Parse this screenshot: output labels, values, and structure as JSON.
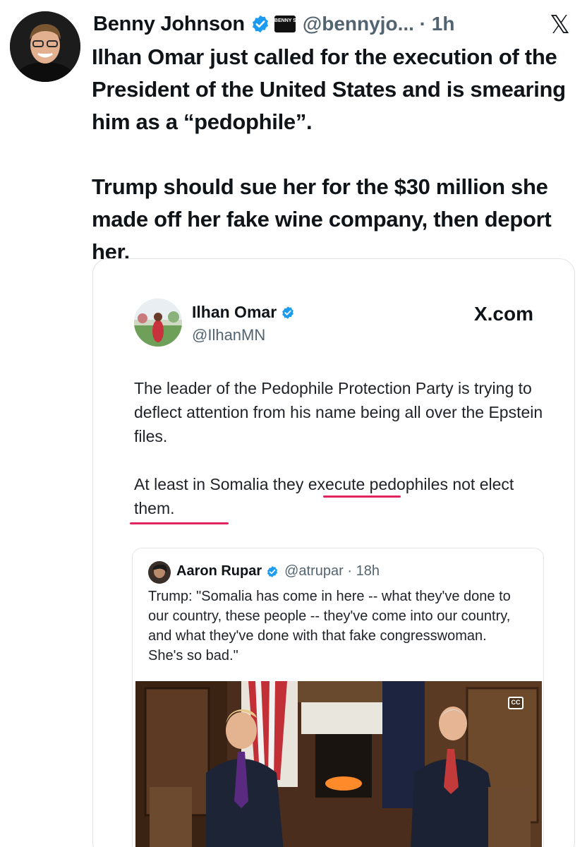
{
  "tweet": {
    "author_name": "Benny Johnson",
    "show_logo_text": "BENNY SHOW",
    "handle_time": "@bennyjo... · 1h",
    "x_logo": "𝕏",
    "paragraphs": [
      "Ilhan Omar just called for the execution of the President of the United States and is smearing him as a “pedophile”.",
      "Trump should sue her for the $30 million she made off her fake wine company, then deport her."
    ]
  },
  "embedded": {
    "name": "Ilhan Omar",
    "handle": "@IlhanMN",
    "source_label": "X.com",
    "paragraphs": [
      "The leader of the Pedophile Protection Party is trying to deflect attention from his name being all over the Epstein files.",
      "At least in Somalia they execute pedophiles not elect them."
    ],
    "quote": {
      "name": "Aaron Rupar",
      "handle_time": "@atrupar · 18h",
      "text": "Trump: \"Somalia has come in here -- what they've done to our country, these people -- they've come into our country, and what they've done with that fake congresswoman. She's so bad.\"",
      "cc_label": "CC"
    }
  },
  "colors": {
    "verified": "#1d9bf0",
    "highlight_underline": "#e0245e",
    "secondary_text": "#536471"
  },
  "icons": {
    "verified": "verified-badge-icon",
    "x": "x-logo-icon",
    "captions": "closed-captions-icon"
  }
}
